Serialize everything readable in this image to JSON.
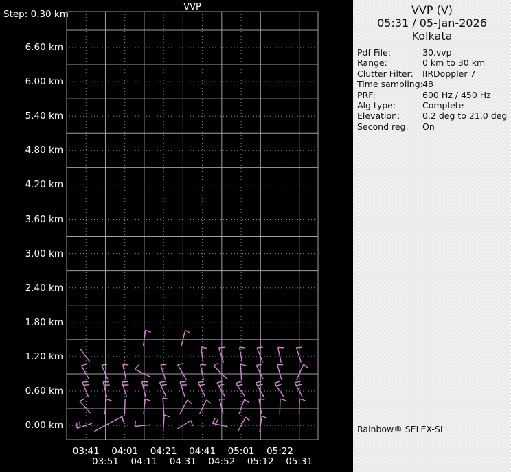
{
  "window": {
    "background": "#000000",
    "panel_background": "#ececec"
  },
  "plot": {
    "title": "VVP",
    "step_label": "Step: 0.30 km",
    "grid_color_solid": "#a0a0a6",
    "grid_color_dotted": "#8f8f95",
    "text_color": "#ffffff",
    "barb_color": "#d783d7",
    "y_ticks": [
      "6.60 km",
      "6.00 km",
      "5.40 km",
      "4.80 km",
      "4.20 km",
      "3.60 km",
      "3.00 km",
      "2.40 km",
      "1.80 km",
      "1.20 km",
      "0.60 km",
      "0.00 km"
    ],
    "x_ticks_row1": [
      "03:41",
      "04:01",
      "04:21",
      "04:41",
      "05:01",
      "05:22"
    ],
    "x_ticks_row2": [
      "03:51",
      "04:11",
      "04:31",
      "04:52",
      "05:12",
      "05:31"
    ]
  },
  "panel": {
    "title": "VVP (V)",
    "datetime": "05:31 / 05-Jan-2026",
    "site": "Kolkata",
    "fields": [
      {
        "label": "Pdf File:",
        "value": "30.vvp"
      },
      {
        "label": "Range:",
        "value": "0 km to 30 km"
      },
      {
        "label": "Clutter Filter:",
        "value": "IIRDoppler 7"
      },
      {
        "label": "Time sampling:",
        "value": "48"
      },
      {
        "label": "PRF:",
        "value": "600 Hz / 450 Hz"
      },
      {
        "label": "Alg type:",
        "value": "Complete"
      },
      {
        "label": "Elevation:",
        "value": "0.2 deg to 21.0 deg"
      },
      {
        "label": "Second reg:",
        "value": "On"
      }
    ],
    "footer": "Rainbow® SELEX-SI"
  },
  "chart_data": {
    "type": "wind-barb-profile",
    "title": "VVP",
    "x_times": [
      "03:41",
      "03:51",
      "04:01",
      "04:11",
      "04:21",
      "04:31",
      "04:41",
      "04:52",
      "05:01",
      "05:12",
      "05:22",
      "05:31"
    ],
    "y_axis": {
      "unit": "km",
      "step_km": 0.3,
      "label_step_km": 0.6,
      "label_max_km": 6.6,
      "label_min_km": 0.0
    },
    "barb_rows_km": [
      1.5,
      1.2,
      0.9,
      0.6,
      0.3,
      0.0
    ],
    "barbs_note": "each barb = [time_index, height_km, staff_angle_deg_cw_from_up, tick_count, length_scale]",
    "barbs": [
      [
        3,
        1.5,
        8,
        1,
        1
      ],
      [
        5,
        1.5,
        14,
        1,
        1
      ],
      [
        0,
        1.2,
        -36,
        0,
        1
      ],
      [
        6,
        1.2,
        -8,
        1,
        1
      ],
      [
        7,
        1.2,
        -18,
        1,
        1
      ],
      [
        8,
        1.2,
        -10,
        1,
        1
      ],
      [
        9,
        1.2,
        -22,
        1,
        1
      ],
      [
        10,
        1.2,
        -12,
        1,
        1
      ],
      [
        11,
        1.2,
        -18,
        1,
        1
      ],
      [
        0,
        0.9,
        -30,
        1,
        1
      ],
      [
        1,
        0.9,
        -24,
        1,
        1
      ],
      [
        2,
        0.9,
        -12,
        1,
        1
      ],
      [
        3,
        0.9,
        -64,
        1,
        1.1
      ],
      [
        4,
        0.9,
        -18,
        1,
        1
      ],
      [
        5,
        0.9,
        -30,
        1,
        1.1
      ],
      [
        6,
        0.9,
        -12,
        1,
        1
      ],
      [
        7,
        0.9,
        -46,
        1,
        1.2
      ],
      [
        8,
        0.9,
        -4,
        1,
        1
      ],
      [
        9,
        0.9,
        -26,
        1,
        1
      ],
      [
        10,
        0.9,
        -16,
        1,
        1
      ],
      [
        11,
        0.9,
        24,
        1,
        1.1
      ],
      [
        0,
        0.6,
        -22,
        2,
        1
      ],
      [
        1,
        0.6,
        -14,
        2,
        1
      ],
      [
        2,
        0.6,
        -18,
        2,
        1
      ],
      [
        3,
        0.6,
        -14,
        2,
        1
      ],
      [
        4,
        0.6,
        -24,
        2,
        1
      ],
      [
        5,
        0.6,
        -18,
        2,
        1
      ],
      [
        6,
        0.6,
        -26,
        2,
        1
      ],
      [
        7,
        0.6,
        -30,
        2,
        1
      ],
      [
        8,
        0.6,
        -34,
        2,
        1
      ],
      [
        9,
        0.6,
        -30,
        2,
        1
      ],
      [
        10,
        0.6,
        -34,
        2,
        1
      ],
      [
        11,
        0.6,
        -28,
        2,
        1
      ],
      [
        0,
        0.3,
        -42,
        1,
        1
      ],
      [
        1,
        0.3,
        6,
        1,
        1
      ],
      [
        2,
        0.3,
        2,
        0,
        1
      ],
      [
        3,
        0.3,
        6,
        1,
        1
      ],
      [
        4,
        0.3,
        -4,
        1,
        1.1
      ],
      [
        5,
        0.3,
        28,
        1,
        1
      ],
      [
        6,
        0.3,
        26,
        1,
        1
      ],
      [
        7,
        0.3,
        -14,
        1,
        1
      ],
      [
        8,
        0.3,
        20,
        1,
        1
      ],
      [
        9,
        0.3,
        -10,
        1,
        1
      ],
      [
        10,
        0.3,
        2,
        1,
        1
      ],
      [
        11,
        0.3,
        2,
        1,
        1
      ],
      [
        0,
        0.0,
        -108,
        2,
        1
      ],
      [
        1,
        0.0,
        62,
        1,
        2.0
      ],
      [
        3,
        0.0,
        -96,
        1,
        1
      ],
      [
        4,
        0.0,
        4,
        1,
        1.1
      ],
      [
        5,
        0.0,
        58,
        1,
        1
      ],
      [
        7,
        0.0,
        -78,
        2,
        1
      ],
      [
        8,
        0.0,
        28,
        1,
        1
      ],
      [
        9,
        0.0,
        8,
        1,
        1
      ]
    ]
  }
}
